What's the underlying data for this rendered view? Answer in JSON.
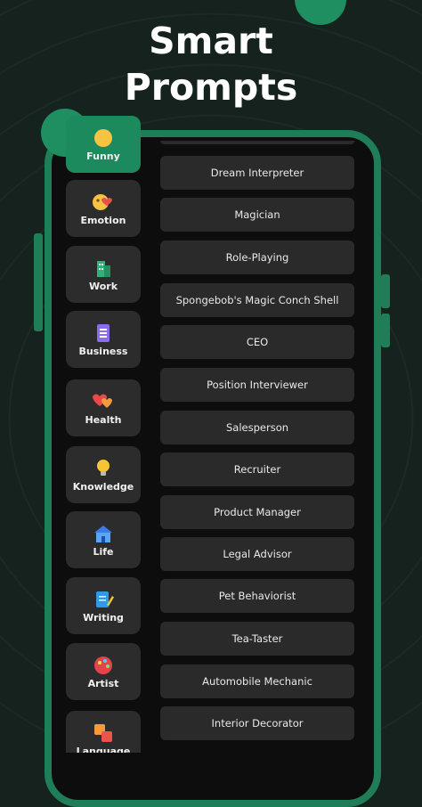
{
  "headline": {
    "line1": "Smart",
    "line2": "Prompts"
  },
  "categories": [
    {
      "label": "Funny",
      "icon": "laughing-face-icon",
      "active": true
    },
    {
      "label": "Emotion",
      "icon": "hearts-face-icon",
      "active": false
    },
    {
      "label": "Work",
      "icon": "building-icon",
      "active": false
    },
    {
      "label": "Business",
      "icon": "document-icon",
      "active": false
    },
    {
      "label": "Health",
      "icon": "hearts-icon",
      "active": false
    },
    {
      "label": "Knowledge",
      "icon": "lightbulb-icon",
      "active": false
    },
    {
      "label": "Life",
      "icon": "house-icon",
      "active": false
    },
    {
      "label": "Writing",
      "icon": "pen-paper-icon",
      "active": false
    },
    {
      "label": "Artist",
      "icon": "palette-icon",
      "active": false
    },
    {
      "label": "Language",
      "icon": "translate-icon",
      "active": false
    }
  ],
  "prompts": [
    "Dream Interpreter",
    "Magician",
    "Role-Playing",
    "Spongebob's Magic Conch Shell",
    "CEO",
    "Position Interviewer",
    "Salesperson",
    "Recruiter",
    "Product Manager",
    "Legal Advisor",
    "Pet Behaviorist",
    "Tea-Taster",
    "Automobile Mechanic",
    "Interior Decorator"
  ],
  "colors": {
    "background": "#16221d",
    "accent": "#1f8f62",
    "phone_frame": "#1f7d57",
    "tile": "#2c2c2c",
    "prompt_bg": "#2a2a2a"
  }
}
